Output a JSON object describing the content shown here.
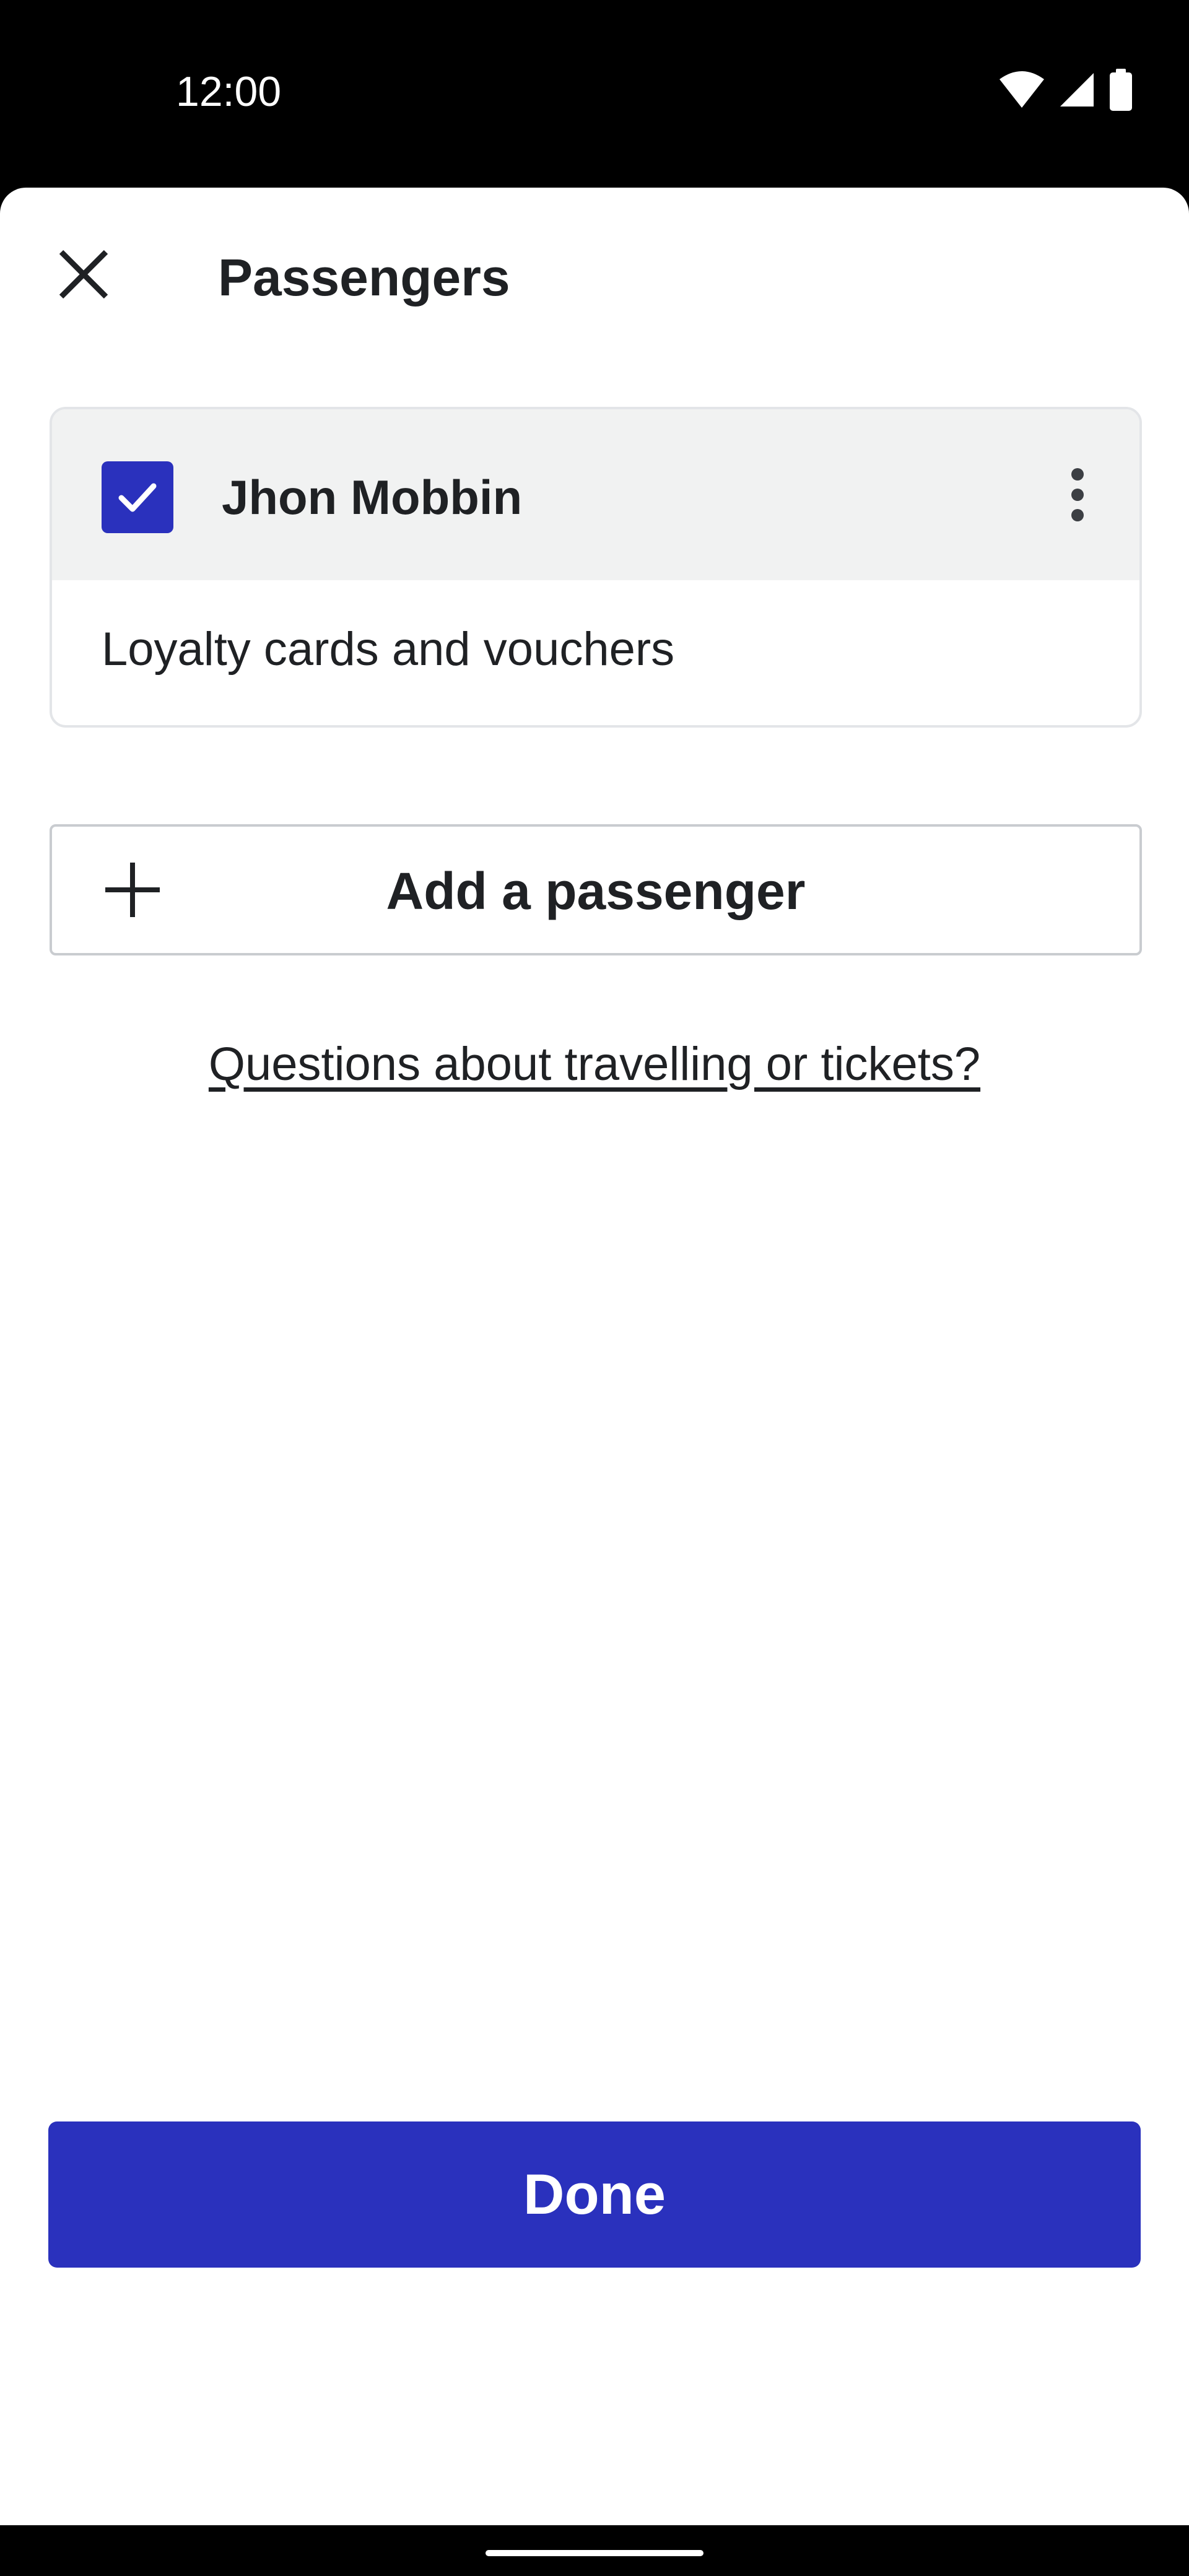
{
  "status_bar": {
    "time": "12:00",
    "icons": [
      "wifi-icon",
      "signal-icon",
      "battery-icon"
    ]
  },
  "header": {
    "title": "Passengers",
    "close_icon": "close-icon"
  },
  "passengers": [
    {
      "name": "Jhon Mobbin",
      "selected": true,
      "extra_label": "Loyalty cards and vouchers"
    }
  ],
  "actions": {
    "add_passenger_label": "Add a passenger",
    "help_link": "Questions about travelling or tickets?",
    "done_label": "Done"
  },
  "colors": {
    "accent": "#2a31bd",
    "header_bg": "#f1f2f2",
    "text": "#1f2124"
  }
}
